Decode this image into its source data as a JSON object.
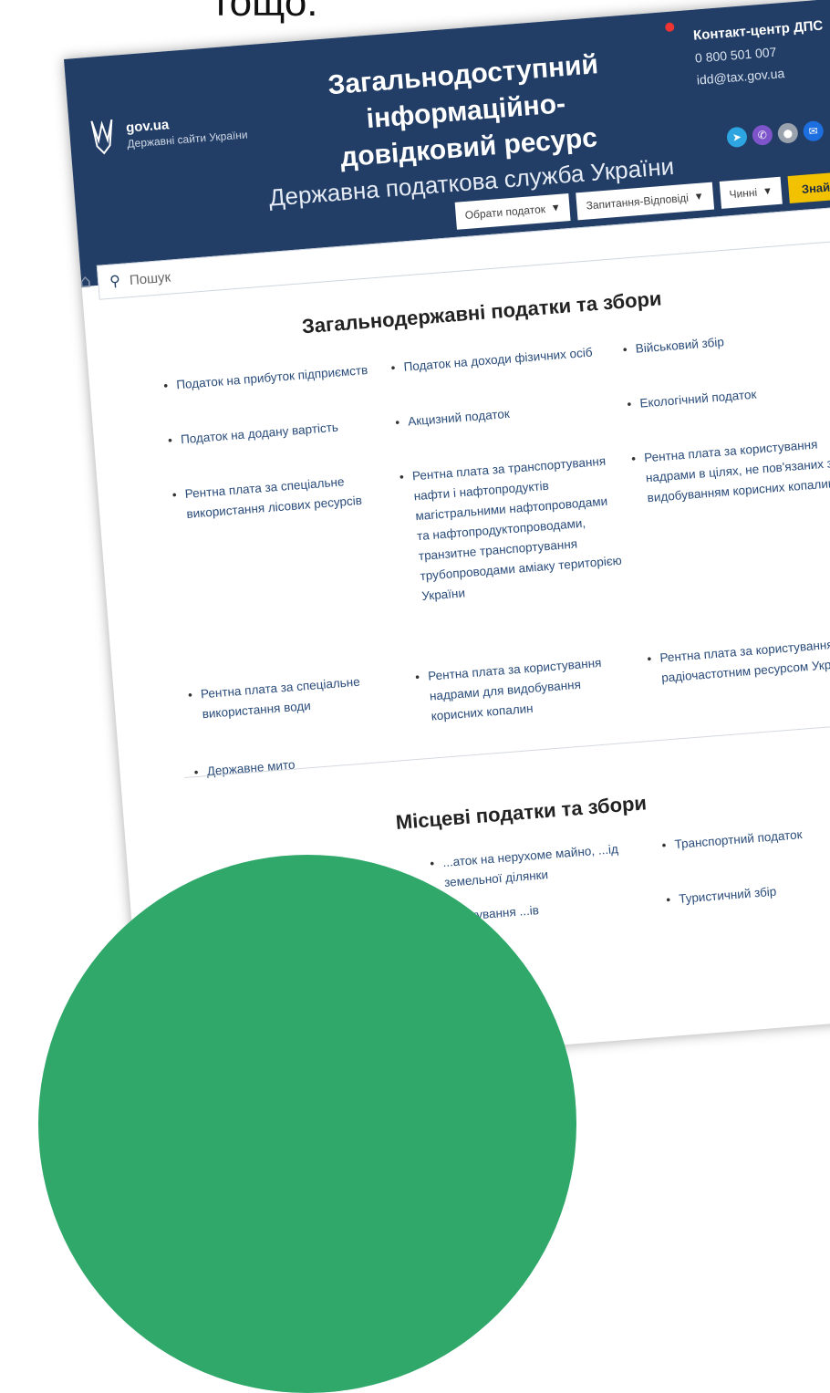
{
  "caption": "тощо.",
  "header": {
    "gov_label": "gov.ua",
    "gov_sub": "Державні сайти України",
    "title_line1": "Загальнодоступний інформаційно-",
    "title_line2": "довідковий ресурс",
    "subtitle": "Державна податкова служба України",
    "contact_title": "Контакт-центр ДПС",
    "phone": "0 800 501 007",
    "email": "idd@tax.gov.ua"
  },
  "filters": {
    "tax_select": "Обрати податок",
    "qa_select": "Запитання-Відповіді",
    "status_select": "Чинні",
    "find_label": "Знайти"
  },
  "search": {
    "placeholder": "Пошук"
  },
  "national": {
    "title": "Загальнодержавні податки та збори",
    "items": [
      "Податок на прибуток підприємств",
      "Податок на доходи фізичних осіб",
      "Військовий збір",
      "Податок на додану вартість",
      "Акцизний податок",
      "Екологічний податок",
      "Рентна плата за спеціальне використання лісових ресурсів",
      "Рентна плата за транспортування нафти і нафтопродуктів магістральними нафтопроводами та нафтопродуктопроводами, транзитне транспортування трубопроводами аміаку територією України",
      "Рентна плата за користування надрами в цілях, не пов'язаних з видобуванням корисних копалин",
      "Рентна плата за спеціальне використання води",
      "Рентна плата за користування надрами для видобування корисних копалин",
      "Рентна плата за користування радіочастотним ресурсом України",
      "Державне мито"
    ]
  },
  "local": {
    "title": "Місцеві податки та збори",
    "items": [
      "...аток на нерухоме майно, ...ід земельної ділянки",
      "Транспортний податок",
      "...аркування ...ів",
      "Туристичний збір"
    ]
  }
}
